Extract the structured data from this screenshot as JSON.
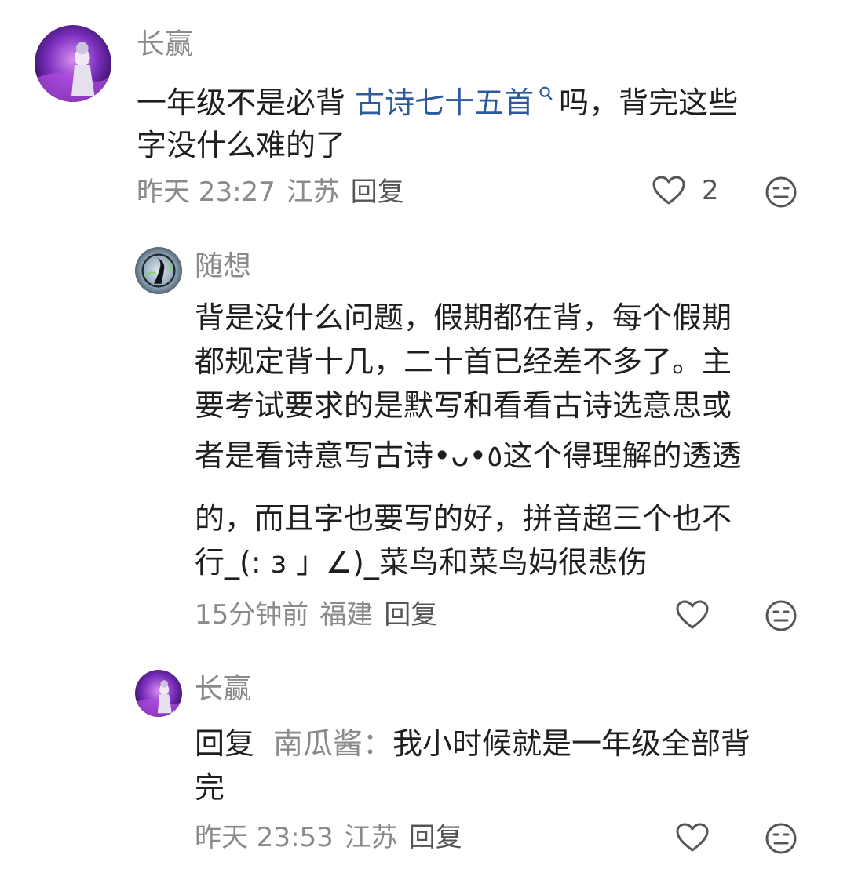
{
  "comments": [
    {
      "username": "长赢",
      "text_before_link": "一年级不是必背 ",
      "link_text": "古诗七十五首",
      "text_after_link": "吗，背完这些",
      "line2": "字没什么难的了",
      "time": "昨天 23:27",
      "location": "江苏",
      "reply_label": "回复",
      "like_count": "2",
      "avatar_icon": "avatar-purple-stage",
      "like_icon": "heart-outline-icon",
      "emoji_icon": "neutral-face-icon"
    },
    {
      "username": "随想",
      "lines": [
        "背是没什么问题，假期都在背，每个假期",
        "都规定背十几，二十首已经差不多了。主",
        "要考试要求的是默写和看看古诗选意思或",
        "者是看诗意写古诗•ᴗ•٥这个得理解的透透",
        "的，而且字也要写的好，拼音超三个也不",
        "行_(: з 」∠)_菜鸟和菜鸟妈很悲伤"
      ],
      "time": "15分钟前",
      "location": "福建",
      "reply_label": "回复",
      "avatar_icon": "avatar-dark-figure",
      "like_icon": "heart-outline-icon",
      "emoji_icon": "neutral-face-icon"
    },
    {
      "username": "长赢",
      "reply_prefix": "回复",
      "reply_target": "南瓜酱：",
      "text": "我小时候就是一年级全部背",
      "line2": "完",
      "time": "昨天 23:53",
      "location": "江苏",
      "reply_label": "回复",
      "avatar_icon": "avatar-purple-stage",
      "like_icon": "heart-outline-icon",
      "emoji_icon": "neutral-face-icon"
    }
  ],
  "colors": {
    "link": "#2c5a9c",
    "meta": "#8a8a8a",
    "text": "#1f1f1f"
  }
}
